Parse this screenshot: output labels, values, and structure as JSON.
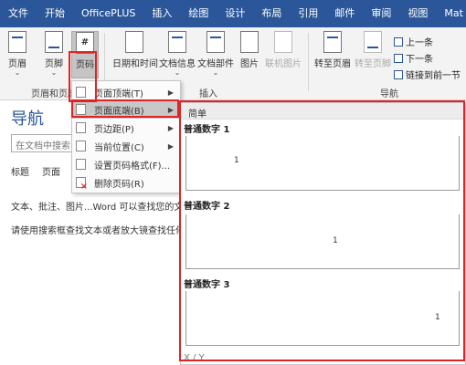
{
  "ribbon_tabs": [
    "文件",
    "开始",
    "OfficePLUS",
    "插入",
    "绘图",
    "设计",
    "布局",
    "引用",
    "邮件",
    "审阅",
    "视图",
    "Mat"
  ],
  "ribbon": {
    "header_btn": "页眉",
    "footer_btn": "页脚",
    "pagenum_btn": "页码",
    "pagenum_icon_char": "#",
    "datetime_btn": "日期和时间",
    "docinfo_btn": "文档信息",
    "docparts_btn": "文档部件",
    "picture_btn": "图片",
    "online_picture_btn": "联机图片",
    "goto_header_btn": "转至页眉",
    "goto_footer_btn": "转至页脚",
    "prev_btn": "上一条",
    "next_btn": "下一条",
    "link_prev_btn": "链接到前一节",
    "group_headerfooter": "页眉和页脚",
    "group_insert": "插入",
    "group_nav": "导航"
  },
  "nav_pane": {
    "title": "导航",
    "search_placeholder": "在文档中搜索",
    "tabs": [
      "标题",
      "页面"
    ],
    "text1": "文本、批注、图片...Word 可以查找您的文档",
    "text2": "请使用搜索框查找文本或者放大镜查找任何"
  },
  "menu": {
    "items": [
      {
        "label": "页面顶端(T)",
        "has_arrow": true
      },
      {
        "label": "页面底端(B)",
        "has_arrow": true
      },
      {
        "label": "页边距(P)",
        "has_arrow": true
      },
      {
        "label": "当前位置(C)",
        "has_arrow": true
      },
      {
        "label": "设置页码格式(F)...",
        "has_arrow": false
      },
      {
        "label": "删除页码(R)",
        "has_arrow": false
      }
    ],
    "arrow_char": "▶"
  },
  "gallery": {
    "header": "简单",
    "items": [
      {
        "label": "普通数字 1",
        "mark": "1"
      },
      {
        "label": "普通数字 2",
        "mark": "1"
      },
      {
        "label": "普通数字 3",
        "mark": "1"
      }
    ],
    "footer": "X / Y"
  },
  "colors": {
    "accent": "#2b579a",
    "highlight_red": "#e02424"
  }
}
